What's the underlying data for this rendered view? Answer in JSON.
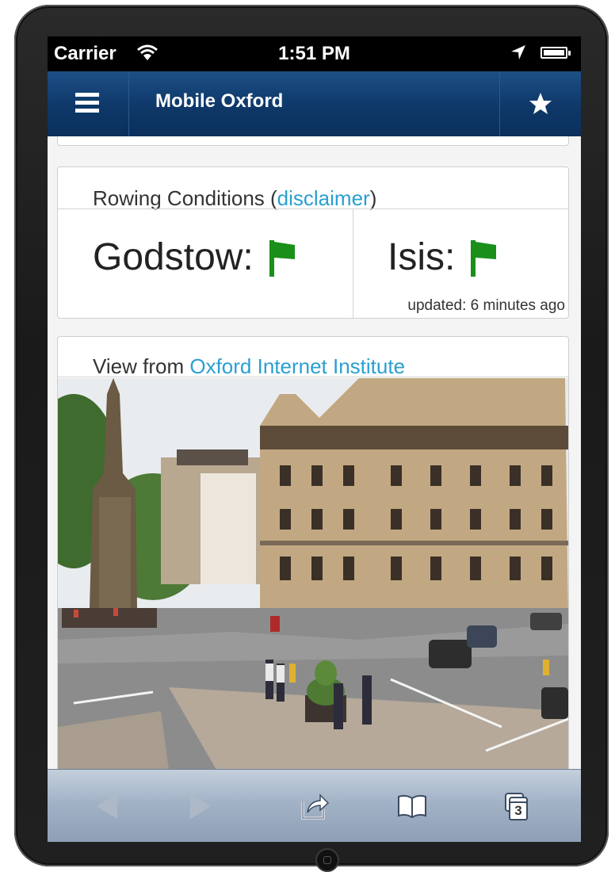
{
  "status_bar": {
    "carrier": "Carrier",
    "time": "1:51 PM"
  },
  "header": {
    "title": "Mobile Oxford",
    "menu_icon": "hamburger-menu-icon",
    "favourite_icon": "star-icon"
  },
  "rowing": {
    "title_prefix": "Rowing Conditions (",
    "disclaimer_link": "disclaimer",
    "title_suffix": ")",
    "sites": [
      {
        "name": "Godstow:",
        "flag_color": "#1a8f1a"
      },
      {
        "name": "Isis:",
        "flag_color": "#1a8f1a"
      }
    ],
    "updated": "updated: 6 minutes ago"
  },
  "webcam": {
    "title_prefix": "View from ",
    "source_link": "Oxford Internet Institute"
  },
  "toolbar": {
    "back_icon": "back-arrow-icon",
    "forward_icon": "forward-arrow-icon",
    "share_icon": "share-icon",
    "bookmarks_icon": "bookmarks-book-icon",
    "tabs_icon": "tabs-icon",
    "tabs_count": "3"
  },
  "colors": {
    "header_blue": "#0e3868",
    "link_blue": "#2a9fd0",
    "flag_green": "#1a8f1a"
  }
}
